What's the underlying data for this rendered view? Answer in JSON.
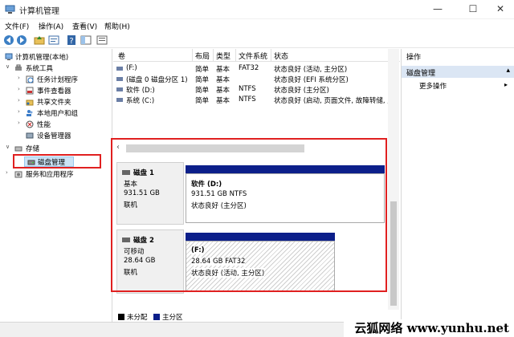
{
  "window": {
    "title": "计算机管理",
    "minimize_glyph": "—",
    "maximize_glyph": "☐",
    "close_glyph": "✕"
  },
  "menu": [
    "文件(F)",
    "操作(A)",
    "查看(V)",
    "帮助(H)"
  ],
  "tree": {
    "root": "计算机管理(本地)",
    "system_tools": "系统工具",
    "task_scheduler": "任务计划程序",
    "event_viewer": "事件查看器",
    "shared_folders": "共享文件夹",
    "local_users": "本地用户和组",
    "performance": "性能",
    "device_manager": "设备管理器",
    "storage": "存储",
    "disk_management": "磁盘管理",
    "services_apps": "服务和应用程序"
  },
  "volume_list": {
    "headers": [
      "卷",
      "布局",
      "类型",
      "文件系统",
      "状态"
    ],
    "rows": [
      [
        "(F:)",
        "简单",
        "基本",
        "FAT32",
        "状态良好 (活动, 主分区)"
      ],
      [
        "(磁盘 0 磁盘分区 1)",
        "简单",
        "基本",
        "",
        "状态良好 (EFI 系统分区)"
      ],
      [
        "软件 (D:)",
        "简单",
        "基本",
        "NTFS",
        "状态良好 (主分区)"
      ],
      [
        "系统 (C:)",
        "简单",
        "基本",
        "NTFS",
        "状态良好 (启动, 页面文件, 故障转储, 主"
      ]
    ]
  },
  "disks": [
    {
      "name": "磁盘 1",
      "type": "基本",
      "size": "931.51 GB",
      "status": "联机",
      "volume": {
        "label": "软件  (D:)",
        "info": "931.51 GB NTFS",
        "status": "状态良好 (主分区)"
      }
    },
    {
      "name": "磁盘 2",
      "type": "可移动",
      "size": "28.64 GB",
      "status": "联机",
      "volume": {
        "label": "(F:)",
        "info": "28.64 GB FAT32",
        "status": "状态良好 (活动, 主分区)"
      }
    }
  ],
  "legend": {
    "unallocated": "未分配",
    "primary": "主分区"
  },
  "actions": {
    "header": "操作",
    "section": "磁盘管理",
    "more": "更多操作"
  },
  "watermark": "云狐网络 www.yunhu.net",
  "colors": {
    "primary_partition": "#0c1f8a",
    "unallocated": "#000000",
    "highlight": "#e02020",
    "selection": "#dbe6f4"
  },
  "icons": [
    "app-icon",
    "back-icon",
    "forward-icon",
    "folder-up-icon",
    "properties-icon",
    "help-icon",
    "view-icon",
    "computer-icon",
    "tools-icon",
    "clock-icon",
    "event-icon",
    "share-icon",
    "users-icon",
    "performance-icon",
    "device-icon",
    "storage-icon",
    "disk-icon",
    "services-icon"
  ]
}
